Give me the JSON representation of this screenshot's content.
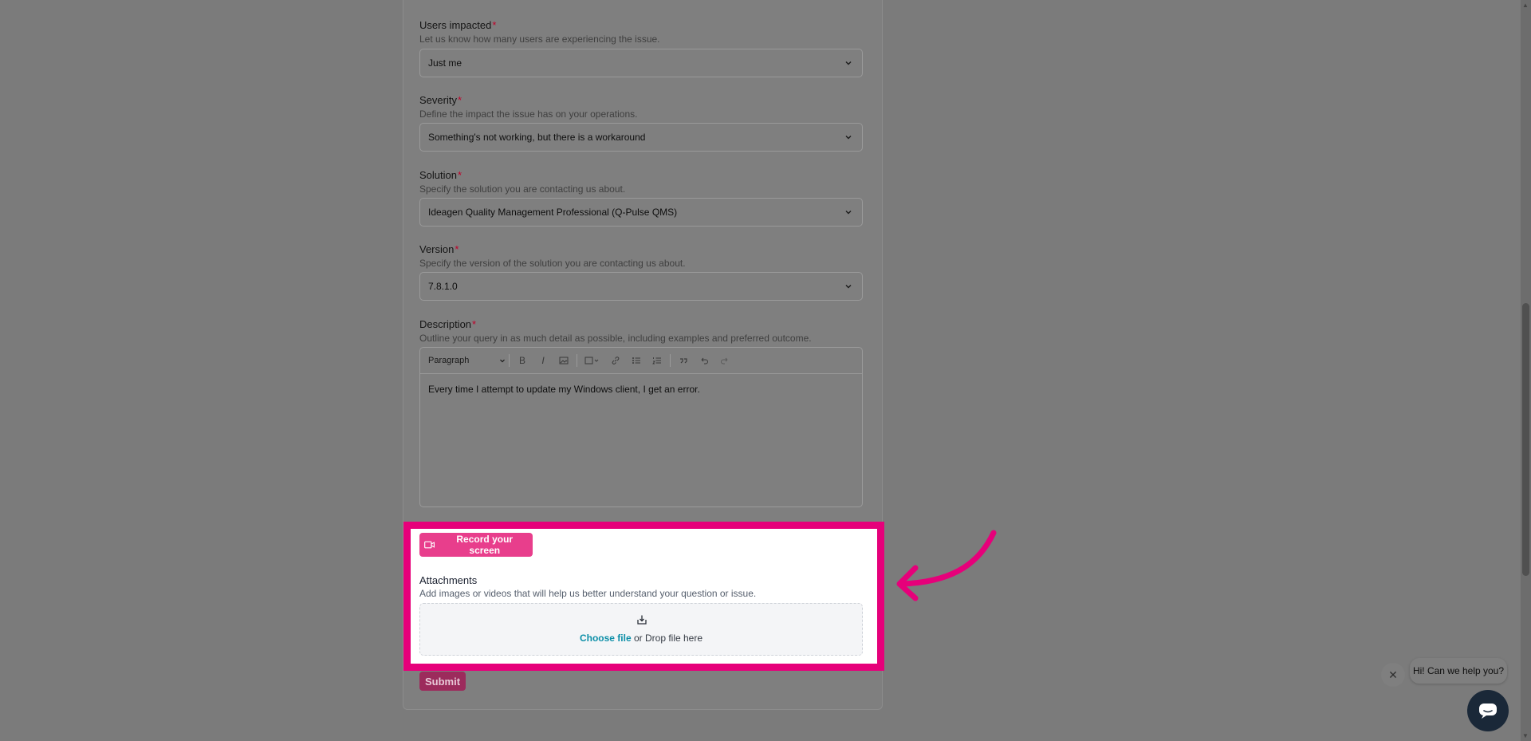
{
  "form": {
    "users_impacted": {
      "label": "Users impacted",
      "required_mark": "*",
      "help": "Let us know how many users are experiencing the issue.",
      "value": "Just me"
    },
    "severity": {
      "label": "Severity",
      "required_mark": "*",
      "help": "Define the impact the issue has on your operations.",
      "value": "Something's not working, but there is a workaround"
    },
    "solution": {
      "label": "Solution",
      "required_mark": "*",
      "help": "Specify the solution you are contacting us about.",
      "value": "Ideagen Quality Management Professional (Q-Pulse QMS)"
    },
    "version": {
      "label": "Version",
      "required_mark": "*",
      "help": "Specify the version of the solution you are contacting us about.",
      "value": "7.8.1.0"
    },
    "description": {
      "label": "Description",
      "required_mark": "*",
      "help": "Outline your query in as much detail as possible, including examples and preferred outcome.",
      "toolbar": {
        "paragraph": "Paragraph",
        "bold": "B",
        "italic": "I"
      },
      "value": "Every time I attempt to update my Windows client, I get an error."
    },
    "record_button": "Record your screen",
    "attachments": {
      "label": "Attachments",
      "help": "Add images or videos that will help us better understand your question or issue.",
      "choose": "Choose file",
      "drop": " or Drop file here"
    },
    "submit": "Submit"
  },
  "chat": {
    "greeting": "Hi! Can we help you?",
    "close": "✕"
  },
  "colors": {
    "highlight": "#e6007a",
    "record_button": "#e83e8c",
    "link": "#0d8fa8",
    "submit": "#9c2b5c"
  }
}
